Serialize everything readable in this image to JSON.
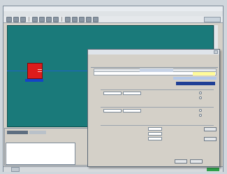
{
  "app": {
    "title_text": ""
  },
  "menubar": {
    "items": [
      "",
      "",
      "",
      "",
      "",
      "",
      ""
    ]
  },
  "toolbar": {
    "right_label": ""
  },
  "canvas": {
    "block_label": ""
  },
  "bottom_panel": {
    "output_lines": [
      "",
      "",
      "",
      "",
      "",
      "",
      "",
      ""
    ]
  },
  "statusbar": {
    "segments": [
      "",
      "",
      "",
      "",
      ""
    ]
  },
  "dialog": {
    "title": "",
    "heading": "",
    "group1_label": "",
    "group2_label": "",
    "group3_label": "",
    "radio_labels": [
      "",
      "",
      "",
      ""
    ],
    "row_labels": [
      "",
      "",
      ""
    ],
    "buttons": [
      "",
      "",
      "",
      ""
    ]
  },
  "colors": {
    "canvas_bg": "#1a7a7a",
    "block_red": "#dd1c1c",
    "label_blue": "#1443c8",
    "status_green": "#2fa04a",
    "dialog_navy": "#1f3f95",
    "grid_yellow": "#fffb9a"
  },
  "icons": [
    "app-icon",
    "close-icon",
    "toolbar-button-icon",
    "minimize-icon"
  ]
}
